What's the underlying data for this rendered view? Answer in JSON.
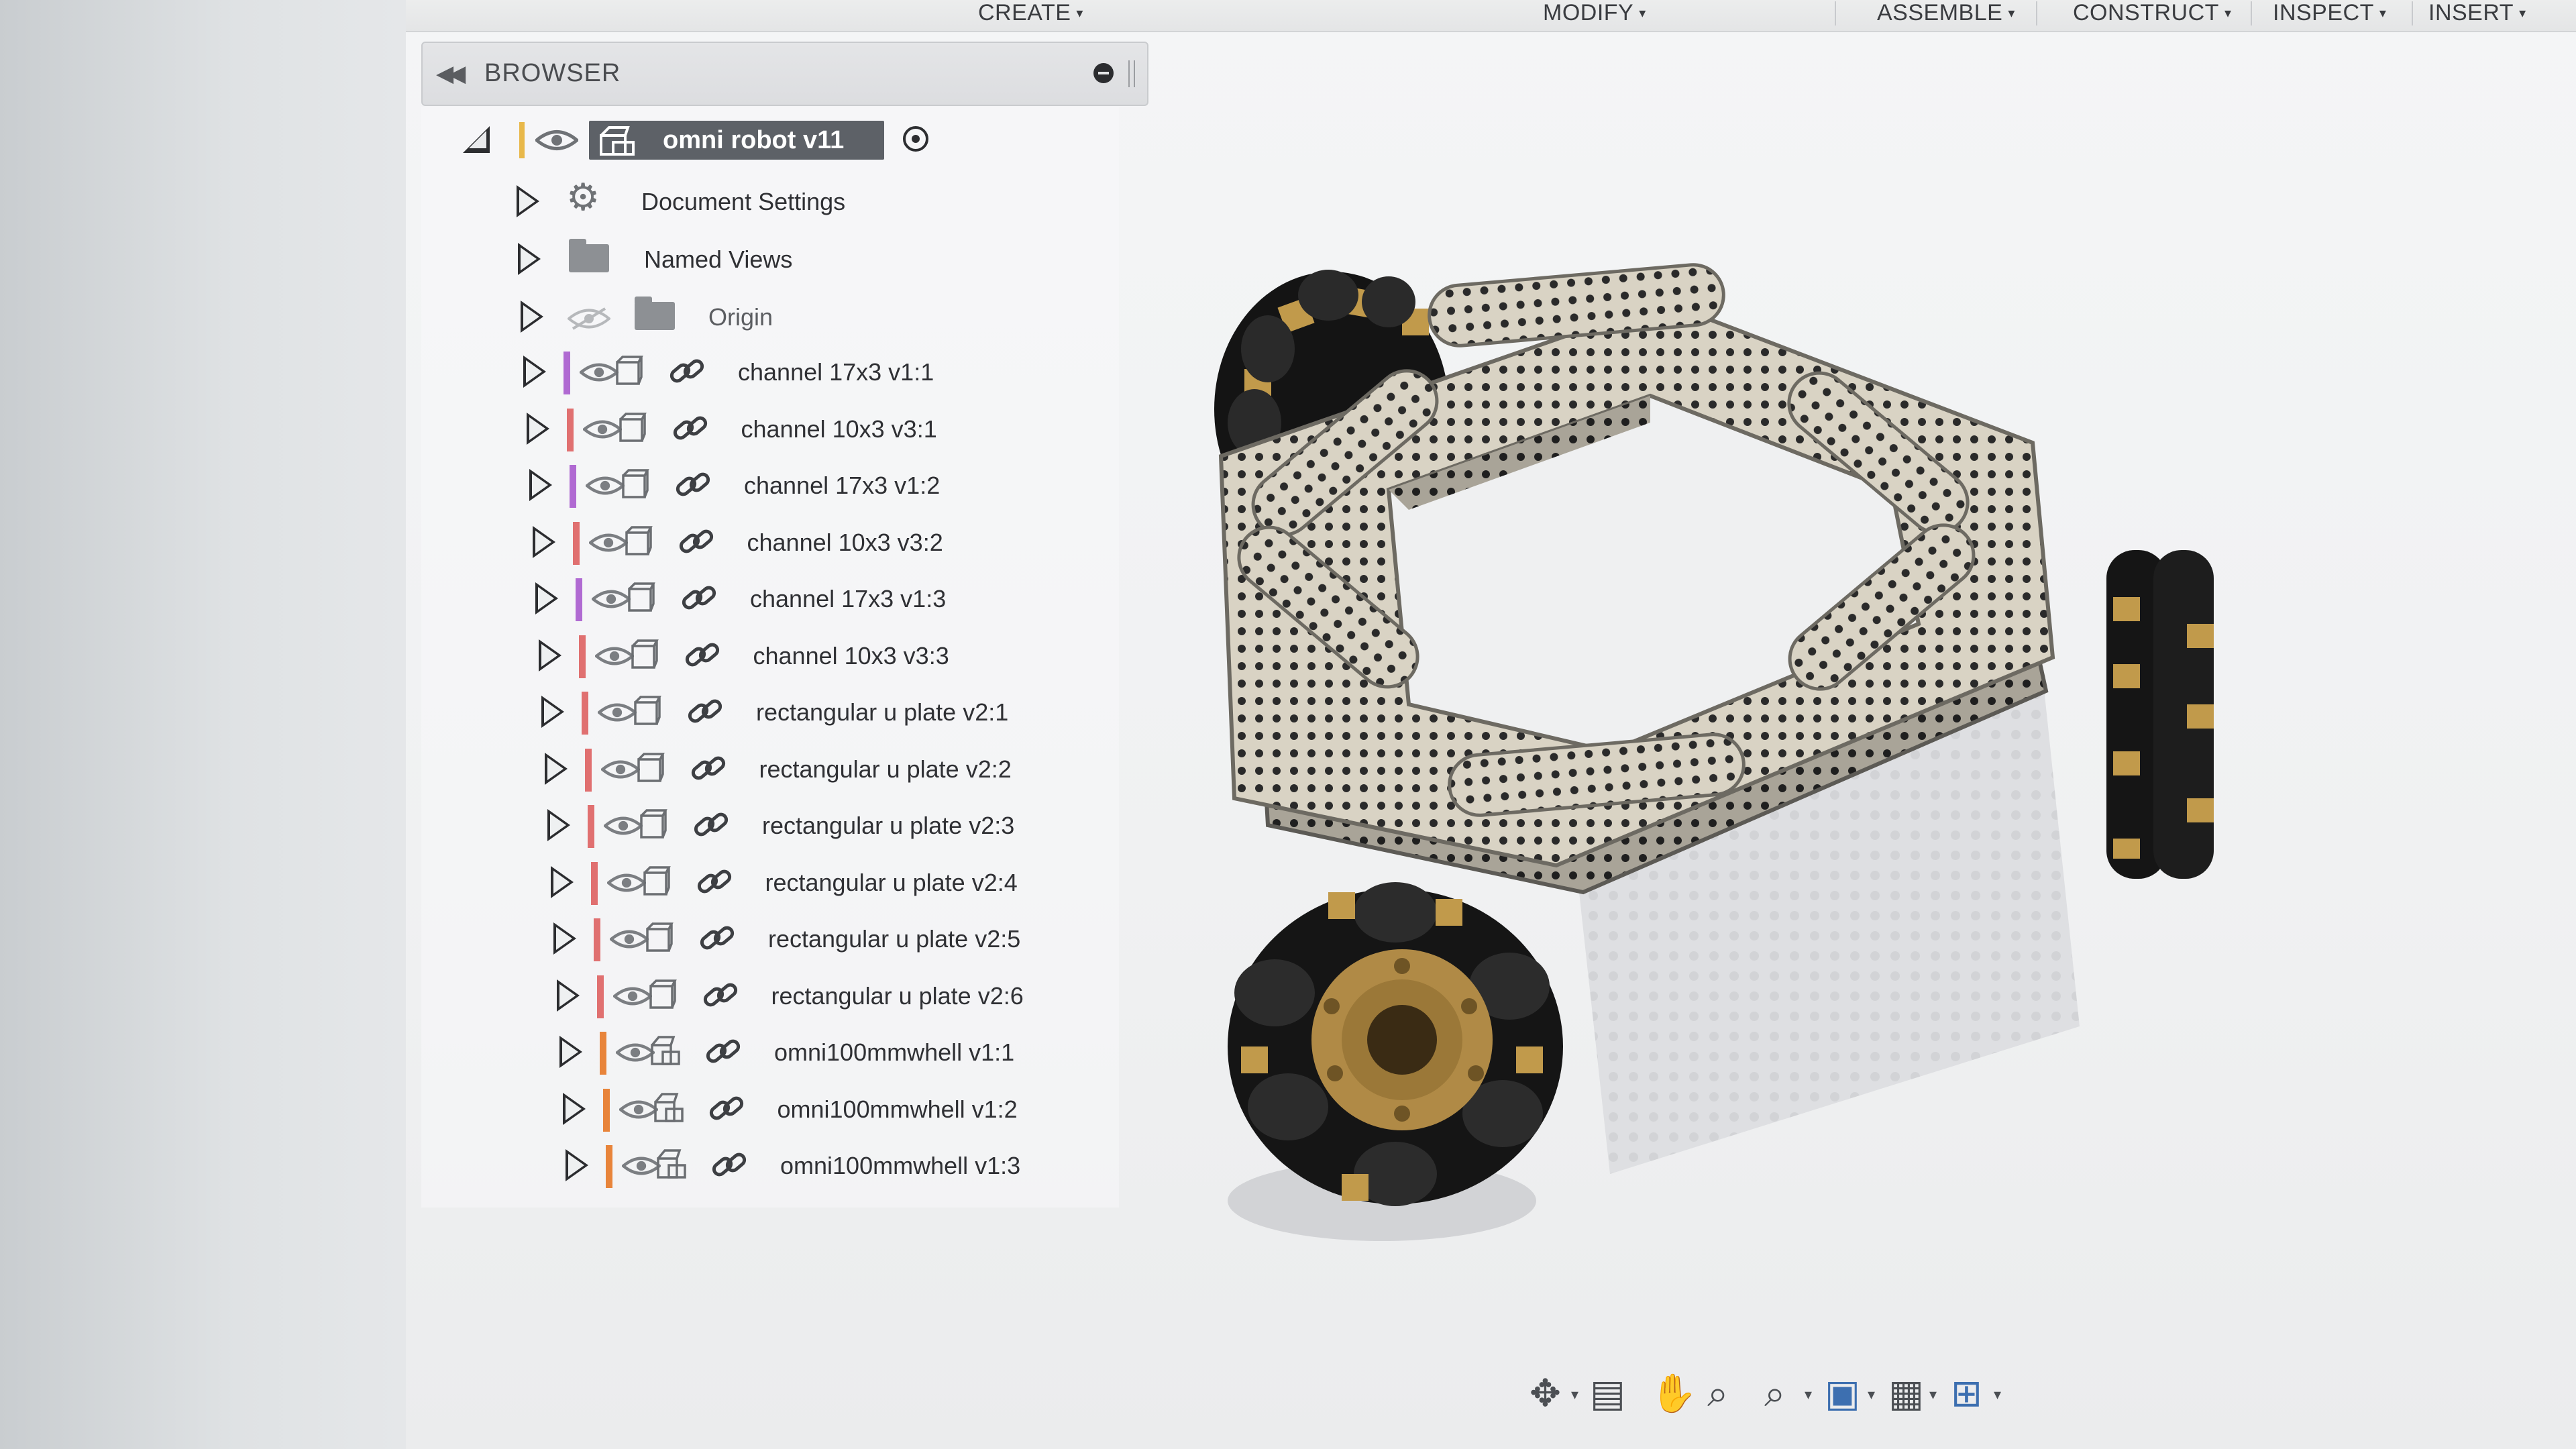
{
  "toolbar": {
    "menus": [
      {
        "label": "CREATE"
      },
      {
        "label": "MODIFY"
      },
      {
        "label": "ASSEMBLE"
      },
      {
        "label": "CONSTRUCT"
      },
      {
        "label": "INSPECT"
      },
      {
        "label": "INSERT"
      }
    ],
    "caret": "▾"
  },
  "browser": {
    "title": "BROWSER",
    "collapse_icon": "double-chevron-left-icon",
    "root": {
      "label": "omni robot v11",
      "color_bar": "#e8b84a"
    },
    "items": [
      {
        "label": "Document Settings",
        "type": "settings"
      },
      {
        "label": "Named Views",
        "type": "folder"
      },
      {
        "label": "Origin",
        "type": "origin",
        "hidden": true
      },
      {
        "label": "channel 17x3 v1:1",
        "color": "#b06ad2",
        "kind": "body"
      },
      {
        "label": "channel 10x3 v3:1",
        "color": "#e07070",
        "kind": "body"
      },
      {
        "label": "channel 17x3 v1:2",
        "color": "#b06ad2",
        "kind": "body"
      },
      {
        "label": "channel 10x3 v3:2",
        "color": "#e07070",
        "kind": "body"
      },
      {
        "label": "channel 17x3 v1:3",
        "color": "#b06ad2",
        "kind": "body"
      },
      {
        "label": "channel 10x3 v3:3",
        "color": "#e07070",
        "kind": "body"
      },
      {
        "label": "rectangular u plate v2:1",
        "color": "#e07070",
        "kind": "body"
      },
      {
        "label": "rectangular u plate v2:2",
        "color": "#e07070",
        "kind": "body"
      },
      {
        "label": "rectangular u plate v2:3",
        "color": "#e07070",
        "kind": "body"
      },
      {
        "label": "rectangular u plate v2:4",
        "color": "#e07070",
        "kind": "body"
      },
      {
        "label": "rectangular u plate v2:5",
        "color": "#e07070",
        "kind": "body"
      },
      {
        "label": "rectangular u plate v2:6",
        "color": "#e07070",
        "kind": "body"
      },
      {
        "label": "omni100mmwhell v1:1",
        "color": "#e8843a",
        "kind": "component"
      },
      {
        "label": "omni100mmwhell v1:2",
        "color": "#e8843a",
        "kind": "component"
      },
      {
        "label": "omni100mmwhell v1:3",
        "color": "#e8843a",
        "kind": "component"
      }
    ]
  },
  "navbar": {
    "icons": [
      "orbit-icon",
      "look-at-icon",
      "pan-hand-icon",
      "zoom-icon",
      "fit-icon",
      "display-settings-icon",
      "grid-icon",
      "viewports-icon"
    ]
  }
}
